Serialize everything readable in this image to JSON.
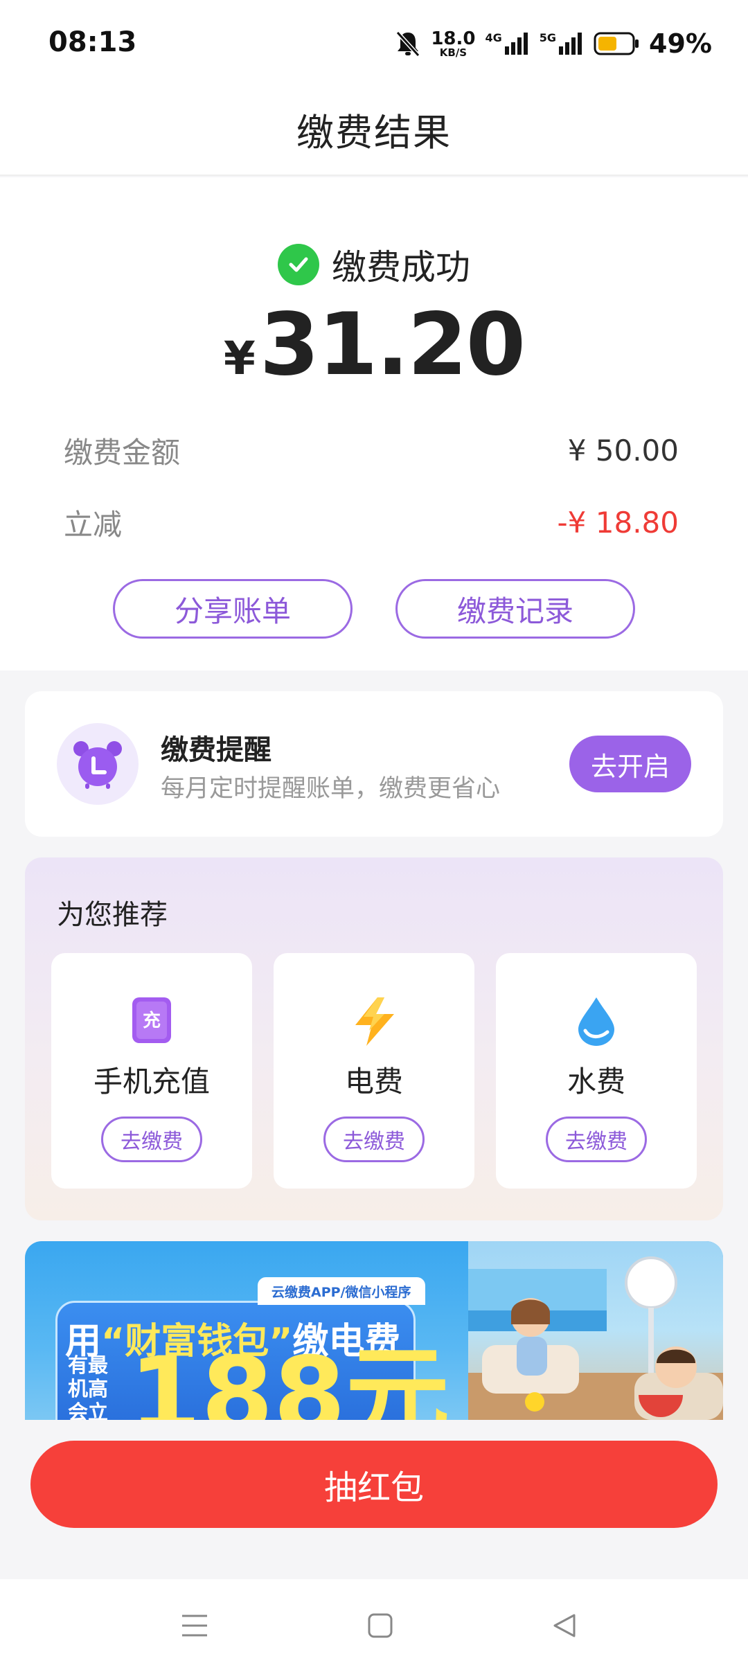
{
  "status_bar": {
    "time": "08:13",
    "net_speed_value": "18.0",
    "net_speed_unit": "KB/S",
    "signal1_label": "4G",
    "signal2_label": "5G",
    "battery_percent": "49%",
    "battery_color": "#f5b400"
  },
  "header": {
    "title": "缴费结果"
  },
  "result": {
    "status_text": "缴费成功",
    "currency_symbol": "¥",
    "paid_amount": "31.20",
    "rows": [
      {
        "label": "缴费金额",
        "value": "¥ 50.00"
      },
      {
        "label": "立减",
        "value": "-¥ 18.80"
      }
    ],
    "share_button": "分享账单",
    "records_button": "缴费记录"
  },
  "reminder": {
    "title": "缴费提醒",
    "subtitle": "每月定时提醒账单，缴费更省心",
    "button": "去开启"
  },
  "recommend": {
    "title": "为您推荐",
    "items": [
      {
        "label": "手机充值",
        "button": "去缴费",
        "icon": "phone-recharge-icon"
      },
      {
        "label": "电费",
        "button": "去缴费",
        "icon": "lightning-icon"
      },
      {
        "label": "水费",
        "button": "去缴费",
        "icon": "water-drop-icon"
      }
    ]
  },
  "banner": {
    "source": "云缴费APP/微信小程序",
    "headline_prefix": "用",
    "headline_highlight": "“财富钱包”",
    "headline_suffix": "缴电费",
    "small_text": "有最机高会立",
    "amount": "188元"
  },
  "cta": {
    "label": "抽红包"
  },
  "colors": {
    "accent_purple": "#9b63e8",
    "success_green": "#2fc74a",
    "discount_red": "#ef3b36",
    "cta_red": "#f6403a"
  }
}
